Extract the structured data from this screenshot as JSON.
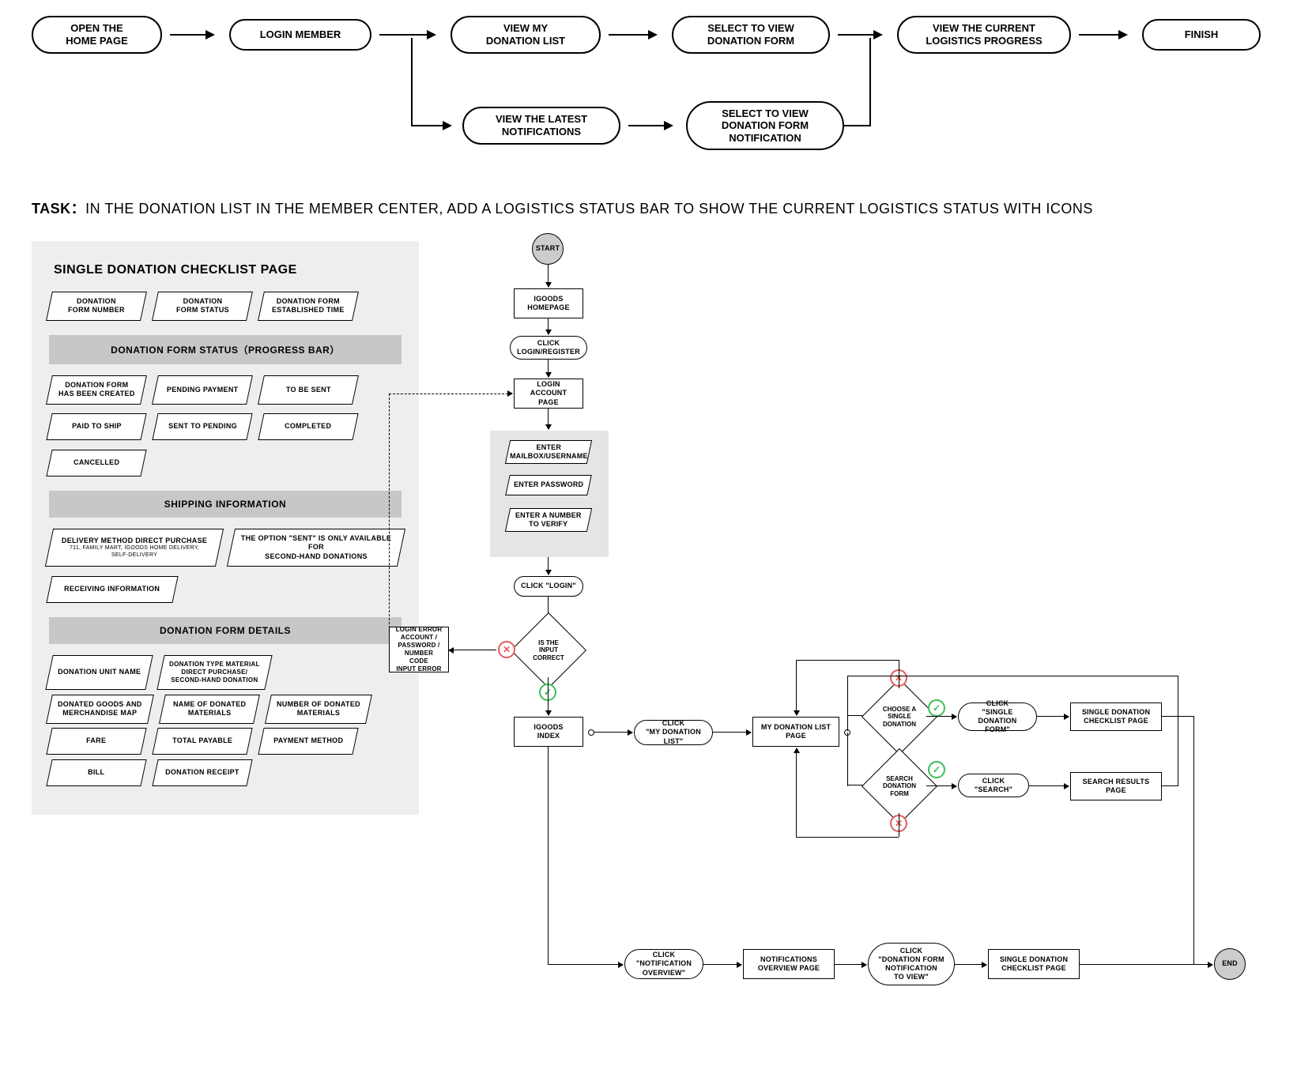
{
  "top_flow": {
    "steps": [
      "OPEN THE\nHOME PAGE",
      "LOGIN MEMBER",
      "VIEW MY\nDONATION LIST",
      "SELECT TO VIEW\nDONATION FORM",
      "VIEW THE CURRENT\nLOGISTICS PROGRESS",
      "FINISH"
    ],
    "branch": [
      "VIEW THE LATEST\nNOTIFICATIONS",
      "SELECT TO VIEW\nDONATION FORM\nNOTIFICATION"
    ]
  },
  "task": {
    "label": "TASK：",
    "text": "IN THE DONATION LIST IN THE MEMBER CENTER, ADD A LOGISTICS STATUS BAR TO SHOW THE CURRENT LOGISTICS STATUS WITH ICONS"
  },
  "panel": {
    "title": "SINGLE DONATION CHECKLIST PAGE",
    "row1": [
      "DONATION\nFORM NUMBER",
      "DONATION\nFORM STATUS",
      "DONATION FORM\nESTABLISHED TIME"
    ],
    "section_progress": "DONATION FORM STATUS（PROGRESS BAR）",
    "progress": [
      "DONATION FORM\nHAS BEEN CREATED",
      "PENDING PAYMENT",
      "TO BE SENT",
      "PAID TO SHIP",
      "SENT TO PENDING",
      "COMPLETED",
      "CANCELLED"
    ],
    "section_shipping": "SHIPPING INFORMATION",
    "shipping": {
      "delivery_main": "DELIVERY METHOD DIRECT PURCHASE",
      "delivery_sub": "711, FAMILY MART, IGOODS HOME DELIVERY,\nSELF-DELIVERY",
      "sent_note": "THE OPTION \"SENT\" IS ONLY AVAILABLE FOR\nSECOND-HAND DONATIONS",
      "receiving": "RECEIVING INFORMATION"
    },
    "section_details": "DONATION FORM DETAILS",
    "details": [
      "DONATION UNIT NAME",
      "DONATION TYPE MATERIAL\nDIRECT PURCHASE/\nSECOND-HAND DONATION",
      "DONATED GOODS AND\nMERCHANDISE MAP",
      "NAME OF DONATED\nMATERIALS",
      "NUMBER OF DONATED\nMATERIALS",
      "FARE",
      "TOTAL PAYABLE",
      "PAYMENT METHOD",
      "BILL",
      "DONATION RECEIPT"
    ]
  },
  "flow": {
    "start": "START",
    "end": "END",
    "homepage": "IGOODS\nHOMEPAGE",
    "click_login": "CLICK\nLOGIN/REGISTER",
    "login_page": "LOGIN\nACCOUNT PAGE",
    "enter_user": "ENTER\nMAILBOX/USERNAME",
    "enter_pass": "ENTER PASSWORD",
    "enter_code": "ENTER A NUMBER\nTO VERIFY",
    "click_login_btn": "CLICK \"LOGIN\"",
    "is_correct": "IS THE\nINPUT\nCORRECT",
    "login_error": "LOGIN ERROR\nACCOUNT /\nPASSWORD /\nNUMBER CODE\nINPUT ERROR",
    "igoods_index": "IGOODS\nINDEX",
    "click_my_list": "CLICK\n\"MY DONATION LIST\"",
    "my_list_page": "MY DONATION LIST\nPAGE",
    "choose_single": "CHOOSE A\nSINGLE DONATION",
    "click_single_form": "CLICK\n\"SINGLE DONATION\nFORM\"",
    "single_checklist": "SINGLE DONATION\nCHECKLIST PAGE",
    "search_form": "SEARCH\nDONATION\nFORM",
    "click_search": "CLICK\n\"SEARCH\"",
    "search_results": "SEARCH RESULTS\nPAGE",
    "click_notif_overview": "CLICK\n\"NOTIFICATION\nOVERVIEW\"",
    "notif_overview_page": "NOTIFICATIONS\nOVERVIEW PAGE",
    "click_notif_to_view": "CLICK\n\"DONATION FORM\nNOTIFICATION\nTO VIEW\"",
    "single_checklist2": "SINGLE DONATION\nCHECKLIST PAGE"
  }
}
